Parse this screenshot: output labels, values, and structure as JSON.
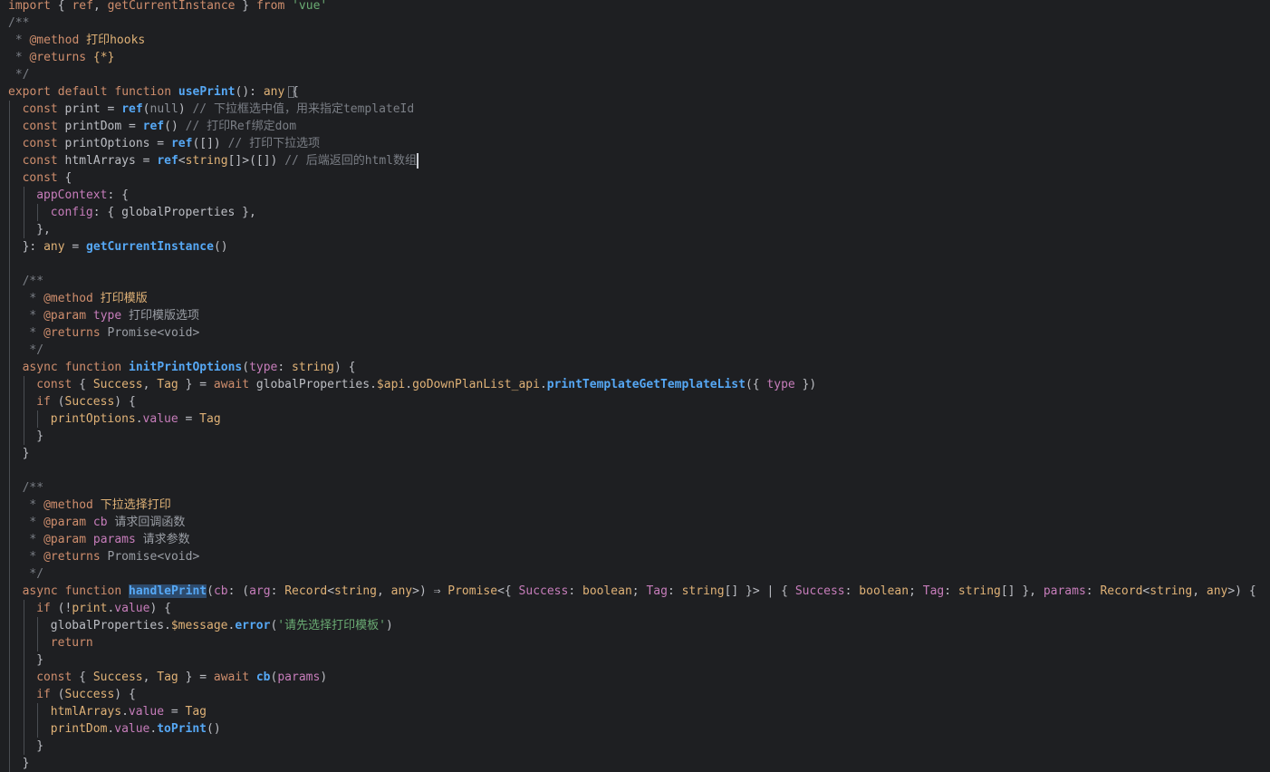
{
  "editor": {
    "language": "typescript",
    "colors": {
      "background": "#1e1f22",
      "keyword": "#cf8e6d",
      "comment": "#7a7e85",
      "function": "#56a8f5",
      "string": "#6aab73",
      "property": "#c77dbb",
      "type": "#e0b277",
      "text": "#bcbec4"
    },
    "lines": [
      {
        "indent": 0,
        "tokens": [
          {
            "t": "import",
            "c": "kw"
          },
          {
            "t": " { ",
            "c": "pu"
          },
          {
            "t": "ref",
            "c": "kw"
          },
          {
            "t": ", ",
            "c": "pu"
          },
          {
            "t": "getCurrentInstance",
            "c": "kw"
          },
          {
            "t": " } ",
            "c": "pu"
          },
          {
            "t": "from",
            "c": "kw"
          },
          {
            "t": " ",
            "c": "pu"
          },
          {
            "t": "'vue'",
            "c": "str"
          }
        ]
      },
      {
        "indent": 0,
        "tokens": [
          {
            "t": "/**",
            "c": "cm"
          }
        ]
      },
      {
        "indent": 0,
        "tokens": [
          {
            "t": " * ",
            "c": "cm"
          },
          {
            "t": "@method",
            "c": "tag"
          },
          {
            "t": " 打印hooks",
            "c": "tagt"
          }
        ]
      },
      {
        "indent": 0,
        "tokens": [
          {
            "t": " * ",
            "c": "cm"
          },
          {
            "t": "@returns",
            "c": "tag"
          },
          {
            "t": " {*}",
            "c": "tagt"
          }
        ]
      },
      {
        "indent": 0,
        "tokens": [
          {
            "t": " */",
            "c": "cm"
          }
        ]
      },
      {
        "indent": 0,
        "tokens": [
          {
            "t": "export",
            "c": "kw"
          },
          {
            "t": " ",
            "c": "pu"
          },
          {
            "t": "default",
            "c": "kw"
          },
          {
            "t": " ",
            "c": "pu"
          },
          {
            "t": "function",
            "c": "kw"
          },
          {
            "t": " ",
            "c": "pu"
          },
          {
            "t": "usePrint",
            "c": "fn"
          },
          {
            "t": "(): ",
            "c": "pu"
          },
          {
            "t": "any",
            "c": "ty"
          },
          {
            "t": " {",
            "c": "pu"
          }
        ]
      },
      {
        "indent": 1,
        "tokens": [
          {
            "t": "const",
            "c": "kw"
          },
          {
            "t": " print = ",
            "c": "var"
          },
          {
            "t": "ref",
            "c": "fn"
          },
          {
            "t": "(",
            "c": "pu"
          },
          {
            "t": "null",
            "c": "lit"
          },
          {
            "t": ") ",
            "c": "pu"
          },
          {
            "t": "// 下拉框选中值，用来指定templateId",
            "c": "cm"
          }
        ]
      },
      {
        "indent": 1,
        "tokens": [
          {
            "t": "const",
            "c": "kw"
          },
          {
            "t": " printDom = ",
            "c": "var"
          },
          {
            "t": "ref",
            "c": "fn"
          },
          {
            "t": "() ",
            "c": "pu"
          },
          {
            "t": "// 打印Ref绑定dom",
            "c": "cm"
          }
        ]
      },
      {
        "indent": 1,
        "tokens": [
          {
            "t": "const",
            "c": "kw"
          },
          {
            "t": " printOptions = ",
            "c": "var"
          },
          {
            "t": "ref",
            "c": "fn"
          },
          {
            "t": "([]) ",
            "c": "pu"
          },
          {
            "t": "// 打印下拉选项",
            "c": "cm"
          }
        ]
      },
      {
        "indent": 1,
        "tokens": [
          {
            "t": "const",
            "c": "kw"
          },
          {
            "t": " htmlArrays = ",
            "c": "var"
          },
          {
            "t": "ref",
            "c": "fn"
          },
          {
            "t": "<",
            "c": "pu"
          },
          {
            "t": "string",
            "c": "ty"
          },
          {
            "t": "[]>([]) ",
            "c": "pu"
          },
          {
            "t": "// 后端返回的html数组",
            "c": "cm"
          }
        ]
      },
      {
        "indent": 1,
        "tokens": [
          {
            "t": "const",
            "c": "kw"
          },
          {
            "t": " {",
            "c": "pu"
          }
        ]
      },
      {
        "indent": 2,
        "tokens": [
          {
            "t": "appContext",
            "c": "prop"
          },
          {
            "t": ": {",
            "c": "pu"
          }
        ]
      },
      {
        "indent": 3,
        "tokens": [
          {
            "t": "config",
            "c": "prop"
          },
          {
            "t": ": { globalProperties },",
            "c": "pu"
          }
        ]
      },
      {
        "indent": 2,
        "tokens": [
          {
            "t": "},",
            "c": "pu"
          }
        ]
      },
      {
        "indent": 1,
        "tokens": [
          {
            "t": "}: ",
            "c": "pu"
          },
          {
            "t": "any",
            "c": "ty"
          },
          {
            "t": " = ",
            "c": "pu"
          },
          {
            "t": "getCurrentInstance",
            "c": "fn"
          },
          {
            "t": "()",
            "c": "pu"
          }
        ]
      },
      {
        "indent": 0,
        "tokens": []
      },
      {
        "indent": 1,
        "tokens": [
          {
            "t": "/**",
            "c": "cm"
          }
        ]
      },
      {
        "indent": 1,
        "tokens": [
          {
            "t": " * ",
            "c": "cm"
          },
          {
            "t": "@method",
            "c": "tag"
          },
          {
            "t": " 打印模版",
            "c": "tagt"
          }
        ]
      },
      {
        "indent": 1,
        "tokens": [
          {
            "t": " * ",
            "c": "cm"
          },
          {
            "t": "@param",
            "c": "tag"
          },
          {
            "t": " type",
            "c": "prop"
          },
          {
            "t": " 打印模版选项",
            "c": "cmcn"
          }
        ]
      },
      {
        "indent": 1,
        "tokens": [
          {
            "t": " * ",
            "c": "cm"
          },
          {
            "t": "@returns",
            "c": "tag"
          },
          {
            "t": " Promise<void>",
            "c": "cmcn"
          }
        ]
      },
      {
        "indent": 1,
        "tokens": [
          {
            "t": " */",
            "c": "cm"
          }
        ]
      },
      {
        "indent": 1,
        "tokens": [
          {
            "t": "async",
            "c": "kw"
          },
          {
            "t": " ",
            "c": "pu"
          },
          {
            "t": "function",
            "c": "kw"
          },
          {
            "t": " ",
            "c": "pu"
          },
          {
            "t": "initPrintOptions",
            "c": "fn"
          },
          {
            "t": "(",
            "c": "pu"
          },
          {
            "t": "type",
            "c": "prop"
          },
          {
            "t": ": ",
            "c": "pu"
          },
          {
            "t": "string",
            "c": "ty"
          },
          {
            "t": ") {",
            "c": "pu"
          }
        ]
      },
      {
        "indent": 2,
        "tokens": [
          {
            "t": "const",
            "c": "kw"
          },
          {
            "t": " { ",
            "c": "pu"
          },
          {
            "t": "Success",
            "c": "ty"
          },
          {
            "t": ", ",
            "c": "pu"
          },
          {
            "t": "Tag",
            "c": "ty"
          },
          {
            "t": " } = ",
            "c": "pu"
          },
          {
            "t": "await",
            "c": "kw"
          },
          {
            "t": " globalProperties.",
            "c": "var"
          },
          {
            "t": "$api",
            "c": "ty"
          },
          {
            "t": ".",
            "c": "pu"
          },
          {
            "t": "goDownPlanList_api",
            "c": "ty"
          },
          {
            "t": ".",
            "c": "pu"
          },
          {
            "t": "printTemplateGetTemplateList",
            "c": "fn"
          },
          {
            "t": "({ ",
            "c": "pu"
          },
          {
            "t": "type",
            "c": "prop"
          },
          {
            "t": " })",
            "c": "pu"
          }
        ]
      },
      {
        "indent": 2,
        "tokens": [
          {
            "t": "if",
            "c": "kw"
          },
          {
            "t": " (",
            "c": "pu"
          },
          {
            "t": "Success",
            "c": "ty"
          },
          {
            "t": ") {",
            "c": "pu"
          }
        ]
      },
      {
        "indent": 3,
        "tokens": [
          {
            "t": "printOptions",
            "c": "ty"
          },
          {
            "t": ".",
            "c": "pu"
          },
          {
            "t": "value",
            "c": "prop"
          },
          {
            "t": " = ",
            "c": "pu"
          },
          {
            "t": "Tag",
            "c": "ty"
          }
        ]
      },
      {
        "indent": 2,
        "tokens": [
          {
            "t": "}",
            "c": "pu"
          }
        ]
      },
      {
        "indent": 1,
        "tokens": [
          {
            "t": "}",
            "c": "pu"
          }
        ]
      },
      {
        "indent": 0,
        "tokens": []
      },
      {
        "indent": 1,
        "tokens": [
          {
            "t": "/**",
            "c": "cm"
          }
        ]
      },
      {
        "indent": 1,
        "tokens": [
          {
            "t": " * ",
            "c": "cm"
          },
          {
            "t": "@method",
            "c": "tag"
          },
          {
            "t": " 下拉选择打印",
            "c": "tagt"
          }
        ]
      },
      {
        "indent": 1,
        "tokens": [
          {
            "t": " * ",
            "c": "cm"
          },
          {
            "t": "@param",
            "c": "tag"
          },
          {
            "t": " cb",
            "c": "prop"
          },
          {
            "t": " 请求回调函数",
            "c": "cmcn"
          }
        ]
      },
      {
        "indent": 1,
        "tokens": [
          {
            "t": " * ",
            "c": "cm"
          },
          {
            "t": "@param",
            "c": "tag"
          },
          {
            "t": " params",
            "c": "prop"
          },
          {
            "t": " 请求参数",
            "c": "cmcn"
          }
        ]
      },
      {
        "indent": 1,
        "tokens": [
          {
            "t": " * ",
            "c": "cm"
          },
          {
            "t": "@returns",
            "c": "tag"
          },
          {
            "t": " Promise<void>",
            "c": "cmcn"
          }
        ]
      },
      {
        "indent": 1,
        "tokens": [
          {
            "t": " */",
            "c": "cm"
          }
        ]
      },
      {
        "indent": 1,
        "tokens": [
          {
            "t": "async",
            "c": "kw"
          },
          {
            "t": " ",
            "c": "pu"
          },
          {
            "t": "function",
            "c": "kw"
          },
          {
            "t": " ",
            "c": "pu"
          },
          {
            "t": "handlePrint",
            "c": "fnh"
          },
          {
            "t": "(",
            "c": "pu"
          },
          {
            "t": "cb",
            "c": "prop"
          },
          {
            "t": ": (",
            "c": "pu"
          },
          {
            "t": "arg",
            "c": "prop"
          },
          {
            "t": ": ",
            "c": "pu"
          },
          {
            "t": "Record",
            "c": "ty"
          },
          {
            "t": "<",
            "c": "pu"
          },
          {
            "t": "string",
            "c": "ty"
          },
          {
            "t": ", ",
            "c": "pu"
          },
          {
            "t": "any",
            "c": "ty"
          },
          {
            "t": ">) ⇒ ",
            "c": "pu"
          },
          {
            "t": "Promise",
            "c": "ty"
          },
          {
            "t": "<{ ",
            "c": "pu"
          },
          {
            "t": "Success",
            "c": "prop"
          },
          {
            "t": ": ",
            "c": "pu"
          },
          {
            "t": "boolean",
            "c": "ty"
          },
          {
            "t": "; ",
            "c": "pu"
          },
          {
            "t": "Tag",
            "c": "prop"
          },
          {
            "t": ": ",
            "c": "pu"
          },
          {
            "t": "string",
            "c": "ty"
          },
          {
            "t": "[] }> | { ",
            "c": "pu"
          },
          {
            "t": "Success",
            "c": "prop"
          },
          {
            "t": ": ",
            "c": "pu"
          },
          {
            "t": "boolean",
            "c": "ty"
          },
          {
            "t": "; ",
            "c": "pu"
          },
          {
            "t": "Tag",
            "c": "prop"
          },
          {
            "t": ": ",
            "c": "pu"
          },
          {
            "t": "string",
            "c": "ty"
          },
          {
            "t": "[] }, ",
            "c": "pu"
          },
          {
            "t": "params",
            "c": "prop"
          },
          {
            "t": ": ",
            "c": "pu"
          },
          {
            "t": "Record",
            "c": "ty"
          },
          {
            "t": "<",
            "c": "pu"
          },
          {
            "t": "string",
            "c": "ty"
          },
          {
            "t": ", ",
            "c": "pu"
          },
          {
            "t": "any",
            "c": "ty"
          },
          {
            "t": ">) {",
            "c": "pu"
          }
        ]
      },
      {
        "indent": 2,
        "tokens": [
          {
            "t": "if",
            "c": "kw"
          },
          {
            "t": " (!",
            "c": "pu"
          },
          {
            "t": "print",
            "c": "ty"
          },
          {
            "t": ".",
            "c": "pu"
          },
          {
            "t": "value",
            "c": "prop"
          },
          {
            "t": ") {",
            "c": "pu"
          }
        ]
      },
      {
        "indent": 3,
        "tokens": [
          {
            "t": "globalProperties.",
            "c": "var"
          },
          {
            "t": "$message",
            "c": "ty"
          },
          {
            "t": ".",
            "c": "pu"
          },
          {
            "t": "error",
            "c": "fn"
          },
          {
            "t": "(",
            "c": "pu"
          },
          {
            "t": "'请先选择打印模板'",
            "c": "str"
          },
          {
            "t": ")",
            "c": "pu"
          }
        ]
      },
      {
        "indent": 3,
        "tokens": [
          {
            "t": "return",
            "c": "kw"
          }
        ]
      },
      {
        "indent": 2,
        "tokens": [
          {
            "t": "}",
            "c": "pu"
          }
        ]
      },
      {
        "indent": 2,
        "tokens": [
          {
            "t": "const",
            "c": "kw"
          },
          {
            "t": " { ",
            "c": "pu"
          },
          {
            "t": "Success",
            "c": "ty"
          },
          {
            "t": ", ",
            "c": "pu"
          },
          {
            "t": "Tag",
            "c": "ty"
          },
          {
            "t": " } = ",
            "c": "pu"
          },
          {
            "t": "await",
            "c": "kw"
          },
          {
            "t": " ",
            "c": "pu"
          },
          {
            "t": "cb",
            "c": "fn"
          },
          {
            "t": "(",
            "c": "pu"
          },
          {
            "t": "params",
            "c": "prop"
          },
          {
            "t": ")",
            "c": "pu"
          }
        ]
      },
      {
        "indent": 2,
        "tokens": [
          {
            "t": "if",
            "c": "kw"
          },
          {
            "t": " (",
            "c": "pu"
          },
          {
            "t": "Success",
            "c": "ty"
          },
          {
            "t": ") {",
            "c": "pu"
          }
        ]
      },
      {
        "indent": 3,
        "tokens": [
          {
            "t": "htmlArrays",
            "c": "ty"
          },
          {
            "t": ".",
            "c": "pu"
          },
          {
            "t": "value",
            "c": "prop"
          },
          {
            "t": " = ",
            "c": "pu"
          },
          {
            "t": "Tag",
            "c": "ty"
          }
        ]
      },
      {
        "indent": 3,
        "tokens": [
          {
            "t": "printDom",
            "c": "ty"
          },
          {
            "t": ".",
            "c": "pu"
          },
          {
            "t": "value",
            "c": "prop"
          },
          {
            "t": ".",
            "c": "pu"
          },
          {
            "t": "toPrint",
            "c": "fn"
          },
          {
            "t": "()",
            "c": "pu"
          }
        ]
      },
      {
        "indent": 2,
        "tokens": [
          {
            "t": "}",
            "c": "pu"
          }
        ]
      },
      {
        "indent": 1,
        "tokens": [
          {
            "t": "}",
            "c": "pu"
          }
        ]
      }
    ]
  }
}
